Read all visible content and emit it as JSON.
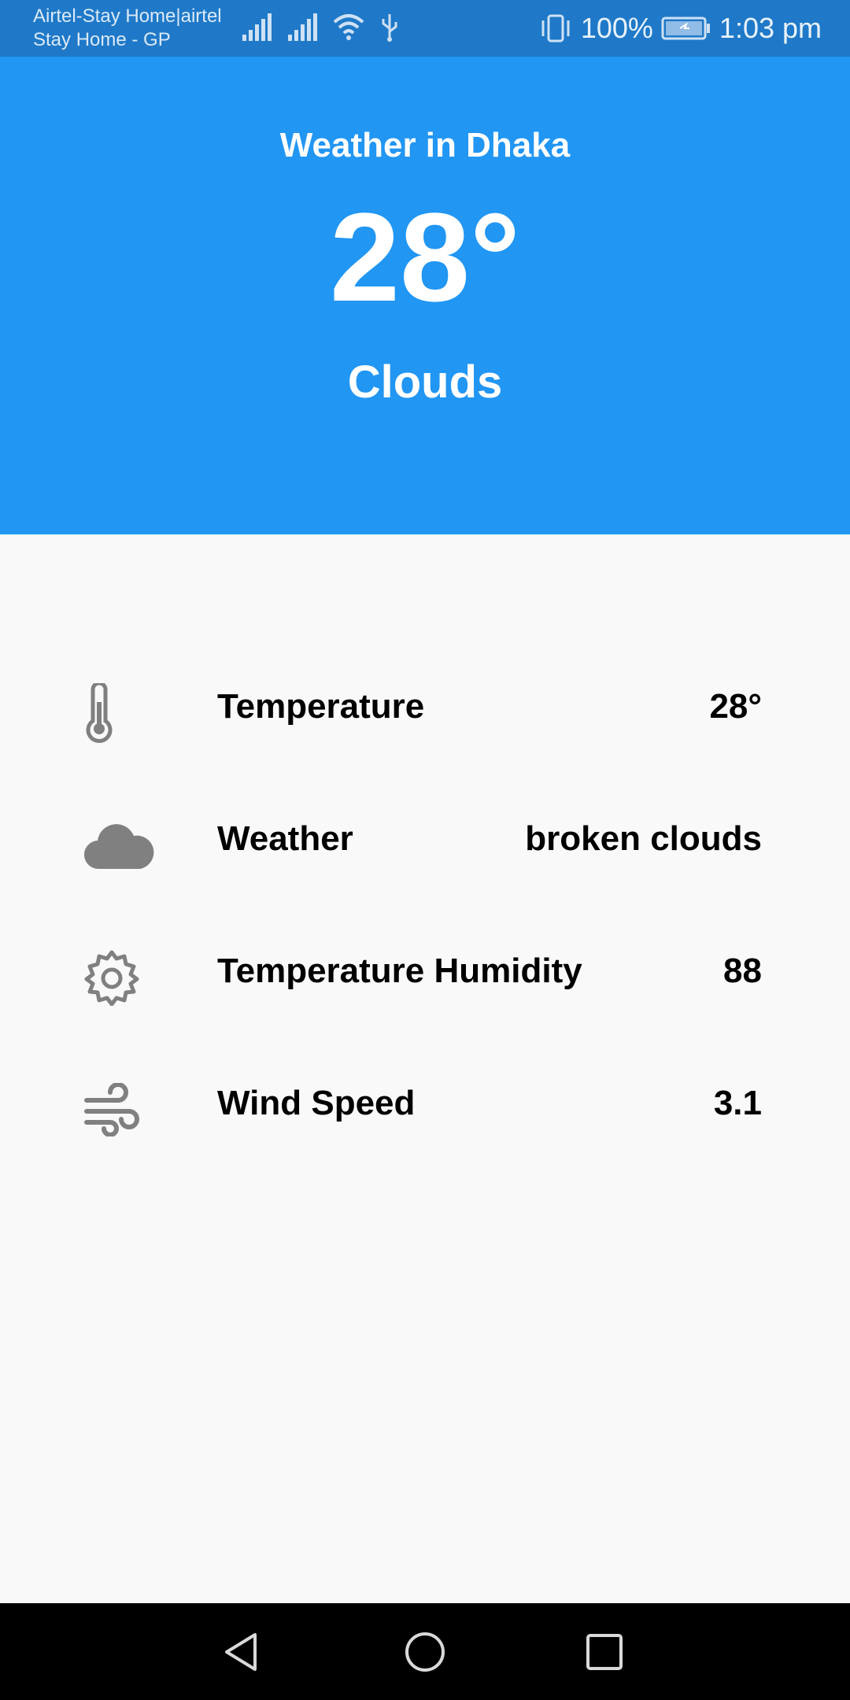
{
  "status_bar": {
    "carrier_line1": "Airtel-Stay Home|airtel",
    "carrier_line2": "Stay Home - GP",
    "battery": "100%",
    "time": "1:03 pm"
  },
  "header": {
    "city_title": "Weather in Dhaka",
    "temperature": "28°",
    "condition": "Clouds",
    "color": "#2196f3"
  },
  "details": [
    {
      "icon": "thermometer-icon",
      "label": "Temperature",
      "value": "28°"
    },
    {
      "icon": "cloud-icon",
      "label": "Weather",
      "value": "broken clouds"
    },
    {
      "icon": "gear-icon",
      "label": "Temperature Humidity",
      "value": "88"
    },
    {
      "icon": "wind-icon",
      "label": "Wind Speed",
      "value": "3.1"
    }
  ],
  "nav_bar": {
    "back": "back-icon",
    "home": "home-icon",
    "recents": "recents-icon"
  }
}
